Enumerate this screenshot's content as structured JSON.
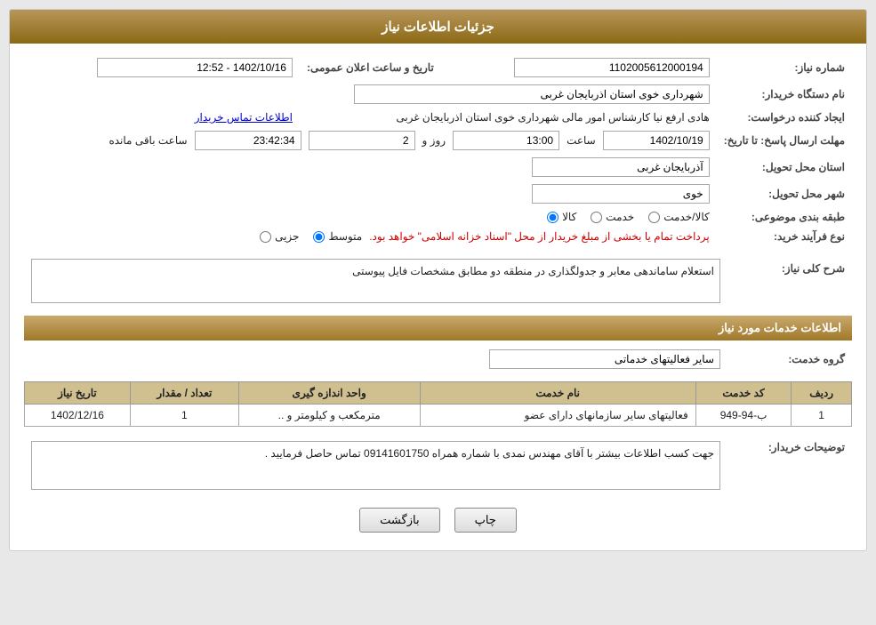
{
  "header": {
    "title": "جزئیات اطلاعات نیاز"
  },
  "fields": {
    "need_number_label": "شماره نیاز:",
    "need_number_value": "1102005612000194",
    "buyer_org_label": "نام دستگاه خریدار:",
    "buyer_org_value": "شهرداری خوی استان اذربایجان غربی",
    "creator_label": "ایجاد کننده درخواست:",
    "creator_value": "هادی ارفع نیا کارشناس امور مالی شهرداری خوی استان اذربایجان غربی",
    "creator_link": "اطلاعات تماس خریدار",
    "announce_date_label": "تاریخ و ساعت اعلان عمومی:",
    "announce_date_value": "1402/10/16 - 12:52",
    "deadline_label": "مهلت ارسال پاسخ: تا تاریخ:",
    "deadline_date": "1402/10/19",
    "deadline_time_label": "ساعت",
    "deadline_time": "13:00",
    "deadline_days_label": "روز و",
    "deadline_days": "2",
    "deadline_remaining_label": "ساعت باقی مانده",
    "deadline_remaining": "23:42:34",
    "province_label": "استان محل تحویل:",
    "province_value": "آذربایجان غربی",
    "city_label": "شهر محل تحویل:",
    "city_value": "خوی",
    "category_label": "طبقه بندی موضوعی:",
    "category_options": [
      "کالا",
      "خدمت",
      "کالا/خدمت"
    ],
    "category_selected": "کالا",
    "purchase_type_label": "نوع فرآیند خرید:",
    "purchase_type_note": "پرداخت تمام یا بخشی از مبلغ خریدار از محل \"اسناد خزانه اسلامی\" خواهد بود.",
    "purchase_types": [
      "جزیی",
      "متوسط"
    ],
    "purchase_type_selected": "متوسط"
  },
  "need_description": {
    "section_label": "شرح کلی نیاز:",
    "value": "استعلام ساماندهی معابر و جدولگذاری در منطقه دو مطابق مشخصات فایل پیوستی"
  },
  "services_section": {
    "section_label": "اطلاعات خدمات مورد نیاز",
    "service_group_label": "گروه خدمت:",
    "service_group_value": "سایر فعالیتهای خدماتی",
    "table_headers": [
      "ردیف",
      "کد خدمت",
      "نام خدمت",
      "واحد اندازه گیری",
      "تعداد / مقدار",
      "تاریخ نیاز"
    ],
    "table_rows": [
      {
        "row": "1",
        "code": "ب-94-949",
        "name": "فعالیتهای سایر سازمانهای دارای عضو",
        "unit": "مترمکعب و کیلومتر و ..",
        "quantity": "1",
        "date": "1402/12/16"
      }
    ]
  },
  "buyer_notes": {
    "section_label": "توضیحات خریدار:",
    "value": "جهت کسب اطلاعات بیشتر با آقای مهندس نمدی با شماره همراه 09141601750 تماس حاصل فرمایید ."
  },
  "buttons": {
    "print": "چاپ",
    "back": "بازگشت"
  }
}
